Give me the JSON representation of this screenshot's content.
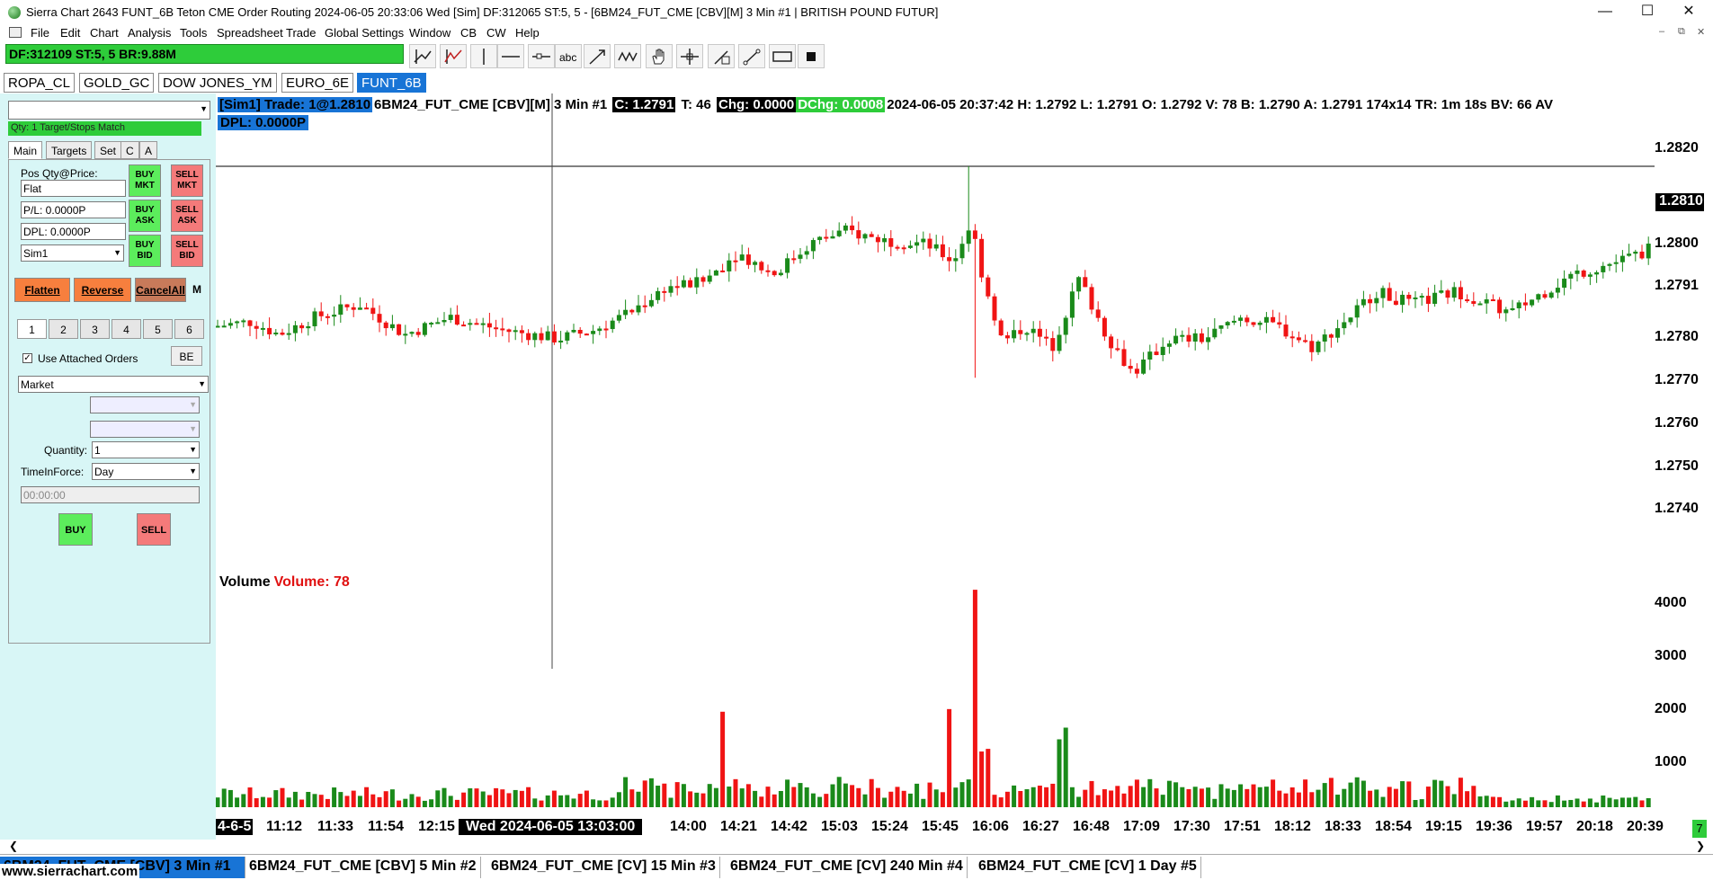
{
  "window": {
    "title": "Sierra Chart 2643 FUNT_6B Teton CME Order Routing 2024-06-05  20:33:06 Wed [Sim] DF:312065  ST:5, 5 - [6BM24_FUT_CME [CBV][M]  3 Min  #1 | BRITISH POUND FUTUR]",
    "minimize": "—",
    "maximize": "☐",
    "close": "✕"
  },
  "menu": [
    "File",
    "Edit",
    "Chart",
    "Analysis",
    "Tools",
    "Spreadsheet",
    "Trade",
    "Global Settings",
    "Window",
    "CB",
    "CW",
    "Help"
  ],
  "mdi_controls": [
    "–",
    "⧉",
    "✕"
  ],
  "status_box": "DF:312109  ST:5, 5  BR:9.88M",
  "toolbar_icons": [
    "draw-lines-icon",
    "draw-tools-icon",
    "vertical-line-icon",
    "horizontal-line-icon",
    "ray-icon",
    "text-tool-icon",
    "arrow-tool-icon",
    "wave-icon",
    "hand-icon",
    "crosshair-icon",
    "measure-icon",
    "fib-icon",
    "rectangle-icon",
    "stop-icon"
  ],
  "chartbook_tabs": [
    {
      "label": "ROPA_CL",
      "active": false
    },
    {
      "label": "GOLD_GC",
      "active": false
    },
    {
      "label": "DOW JONES_YM",
      "active": false
    },
    {
      "label": "EURO_6E",
      "active": false
    },
    {
      "label": "FUNT_6B",
      "active": true
    }
  ],
  "trade_window": {
    "qty_status": "Qty: 1 Target/Stops Match",
    "tabs": [
      {
        "label": "Main",
        "active": true
      },
      {
        "label": "Targets",
        "active": false
      },
      {
        "label": "Set",
        "active": false
      },
      {
        "label": "C",
        "active": false
      },
      {
        "label": "A",
        "active": false
      }
    ],
    "pos_label": "Pos Qty@Price:",
    "pos_value": "Flat",
    "pl_value": "P/L: 0.0000P",
    "dpl_value": "DPL: 0.0000P",
    "account": "Sim1",
    "buy_mkt": [
      "BUY",
      "MKT"
    ],
    "sell_mkt": [
      "SELL",
      "MKT"
    ],
    "buy_ask": [
      "BUY",
      "ASK"
    ],
    "sell_ask": [
      "SELL",
      "ASK"
    ],
    "buy_bid": [
      "BUY",
      "BID"
    ],
    "sell_bid": [
      "SELL",
      "BID"
    ],
    "flatten": "Flatten",
    "reverse": "Reverse",
    "cancel_all": "CancelAll",
    "m_button": "M",
    "number_buttons": [
      "1",
      "2",
      "3",
      "4",
      "5",
      "6"
    ],
    "use_attached_orders": "Use Attached Orders",
    "use_attached_checked": true,
    "be_button": "BE",
    "order_type": "Market",
    "quantity_label": "Quantity:",
    "quantity_value": "1",
    "tif_label": "TimeInForce:",
    "tif_value": "Day",
    "time_value": "00:00:00",
    "buy": "BUY",
    "sell": "SELL"
  },
  "chart": {
    "info": {
      "sim": "[Sim1]  Trade: 1@1.2810",
      "symbol": "6BM24_FUT_CME [CBV][M]  3 Min  #1",
      "close": "C: 1.2791",
      "trades": "T: 46",
      "change": "Chg: 0.0000",
      "dchange": "DChg: 0.0008",
      "rest": "2024-06-05 20:37:42 H: 1.2792  L: 1.2791  O: 1.2792  V: 78  B: 1.2790  A: 1.2791  174x14  TR: 1m 18s  BV: 66  AV",
      "dpl": "DPL: 0.0000P"
    },
    "price_labels": [
      "1.2820",
      "1.2800",
      "1.2791",
      "1.2780",
      "1.2770",
      "1.2760",
      "1.2750",
      "1.2740"
    ],
    "last_price_label": "1.2810",
    "volume_title": "Volume",
    "volume_value": "Volume: 78",
    "volume_labels": [
      "4000",
      "3000",
      "2000",
      "1000"
    ],
    "x_first": "4-6-5",
    "x_cursor": "Wed 2024-06-05  13:03:00",
    "x_labels": [
      "11:12",
      "11:33",
      "11:54",
      "12:15",
      "14:00",
      "14:21",
      "14:42",
      "15:03",
      "15:24",
      "15:45",
      "16:06",
      "16:27",
      "16:48",
      "17:09",
      "17:30",
      "17:51",
      "18:12",
      "18:33",
      "18:54",
      "19:15",
      "19:36",
      "19:57",
      "20:18",
      "20:39"
    ],
    "badge": "7",
    "colors": {
      "up": "#1a8a1a",
      "down": "#f01414"
    }
  },
  "bottom_tabs": [
    {
      "label": "6BM24_FUT_CME [CBV]  3 Min  #1",
      "active": true
    },
    {
      "label": "6BM24_FUT_CME [CBV]  5 Min  #2",
      "active": false
    },
    {
      "label": "6BM24_FUT_CME [CV]  15 Min  #3",
      "active": false
    },
    {
      "label": "6BM24_FUT_CME [CV]  240 Min  #4",
      "active": false
    },
    {
      "label": "6BM24_FUT_CME [CV]  1 Day  #5",
      "active": false
    }
  ],
  "site_url": "www.sierrachart.com"
}
